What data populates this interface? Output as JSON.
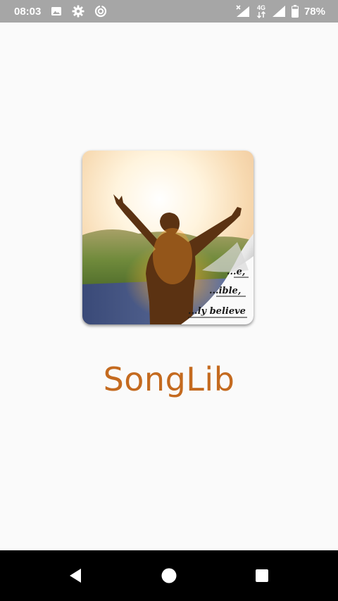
{
  "status_bar": {
    "time": "08:03",
    "network_type": "4G",
    "battery_percent": "78%",
    "battery_level": 0.78,
    "left_icons": [
      "image-icon",
      "gear-icon",
      "data-saver-icon"
    ],
    "right_icons": [
      "signal-no-data-icon",
      "network-4g-icon",
      "signal-icon",
      "battery-icon"
    ]
  },
  "splash": {
    "app_name": "SongLib",
    "logo_text": [
      "...e,",
      "...ible,",
      "...ly believe"
    ],
    "colors": {
      "app_name": "#c46a1f",
      "status_bar": "#a6a6a6",
      "nav_bar": "#000000"
    }
  },
  "nav_bar": {
    "buttons": [
      "back-icon",
      "home-icon",
      "recents-icon"
    ]
  }
}
